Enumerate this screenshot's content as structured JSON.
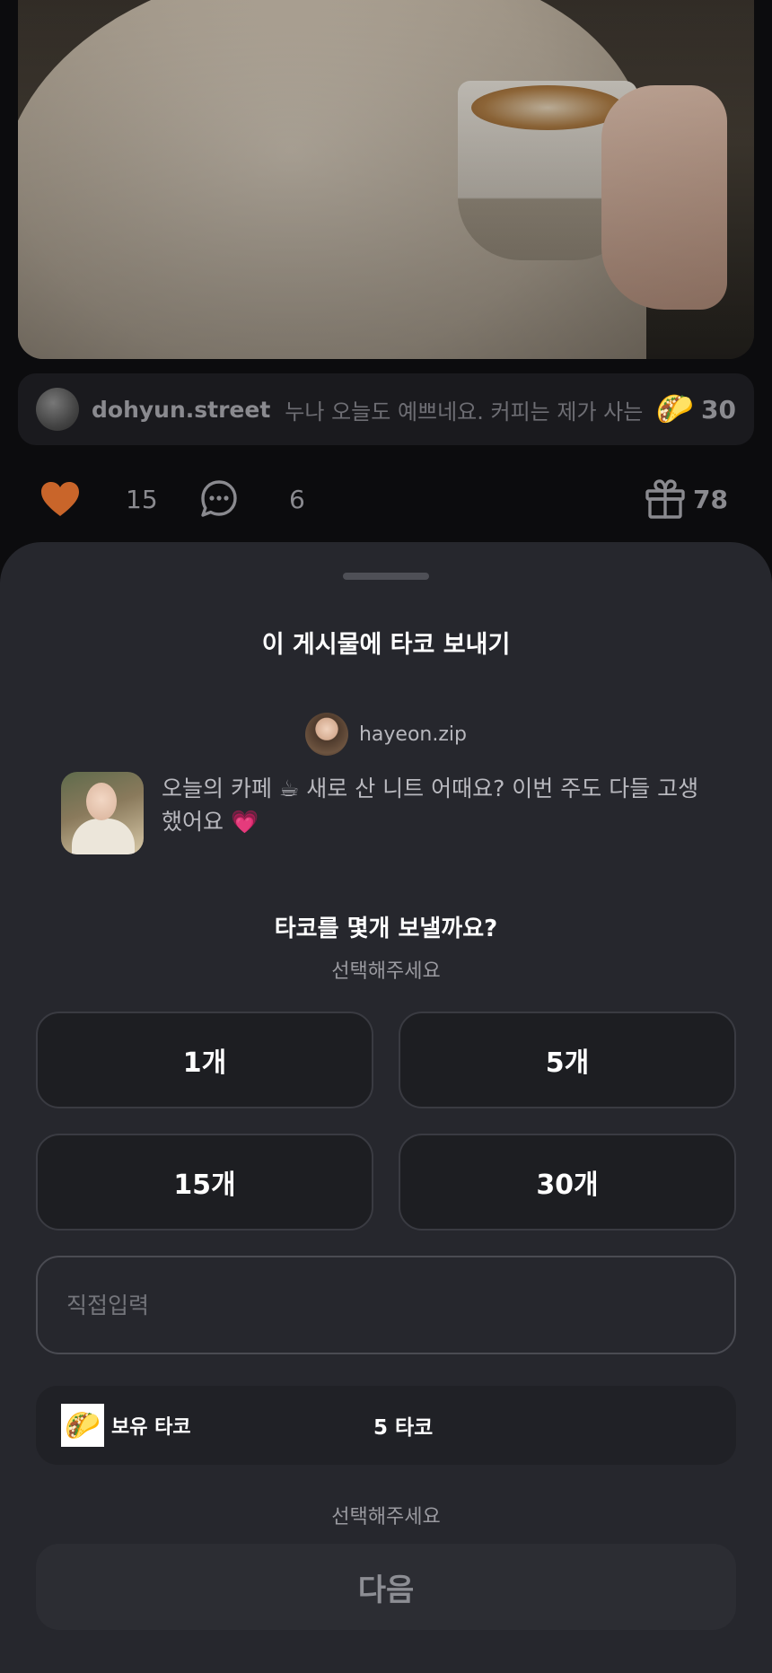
{
  "feed": {
    "comment": {
      "username": "dohyun.street",
      "text": "누나 오늘도 예쁘네요. 커피는 제가 사는 걸...",
      "taco_icon": "🌮",
      "taco_count": "30"
    },
    "actions": {
      "likes": "15",
      "comments": "6",
      "gifts": "78"
    },
    "colors": {
      "heart": "#c9652a",
      "icon_gray": "#8a8a8f"
    }
  },
  "sheet": {
    "title": "이 게시물에 타코 보내기",
    "author": {
      "name": "hayeon.zip"
    },
    "post_text": "오늘의 카페 ☕ 새로 산 니트 어때요? 이번 주도 다들 고생했어요 💗",
    "question": "타코를 몇개 보낼까요?",
    "question_sub": "선택해주세요",
    "options": [
      "1개",
      "5개",
      "15개",
      "30개"
    ],
    "direct_input_placeholder": "직접입력",
    "owned": {
      "icon": "🌮",
      "label": "보유 타코",
      "value": "5 타코"
    },
    "hint": "선택해주세요",
    "next_label": "다음"
  }
}
